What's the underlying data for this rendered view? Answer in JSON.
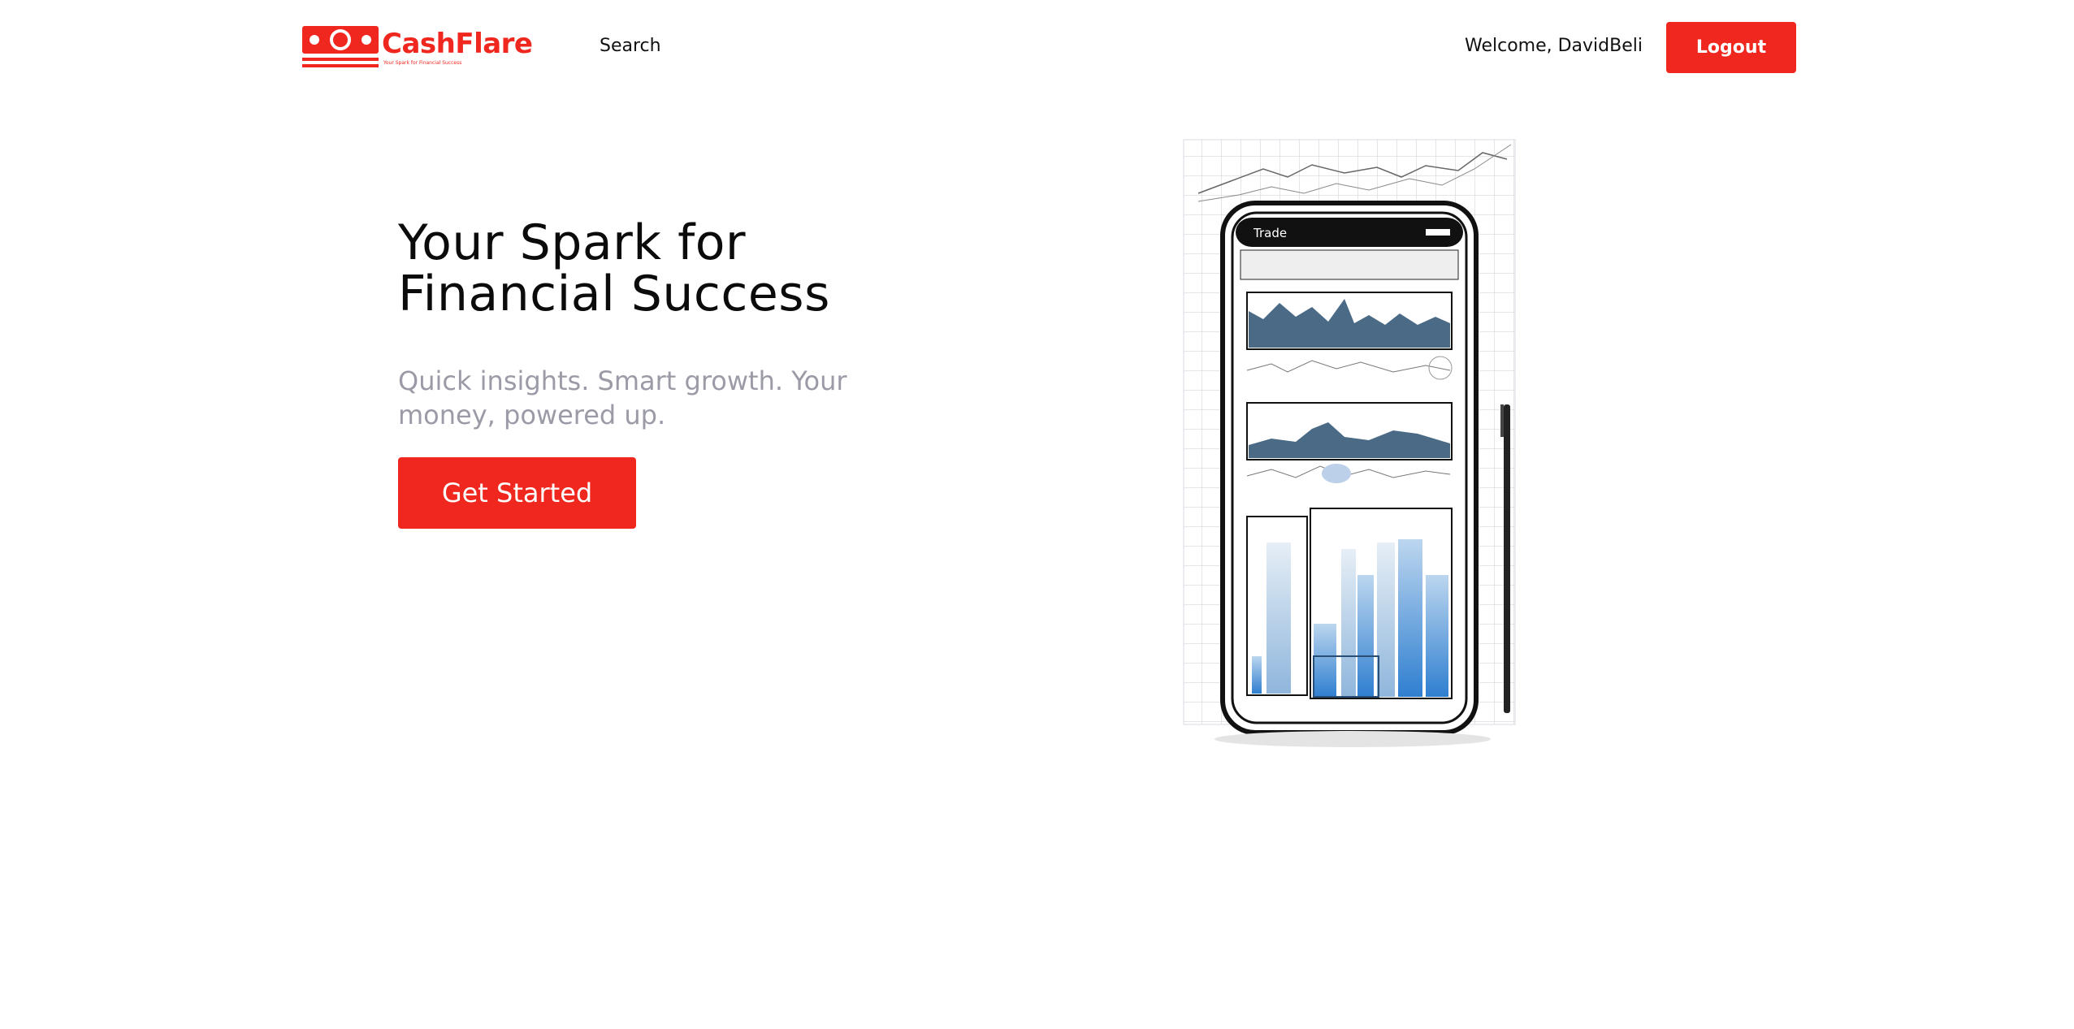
{
  "colors": {
    "accent": "#f0271e",
    "subtitle": "#9a9ba6",
    "chart": "#4a6a86",
    "bars": "#3d8fd9"
  },
  "brand": {
    "name": "CashFlare",
    "tagline": "Your Spark for Financial Success"
  },
  "nav": {
    "search_label": "Search"
  },
  "user": {
    "welcome_text": "Welcome, DavidBeli",
    "logout_label": "Logout"
  },
  "hero": {
    "title_line1": "Your Spark for",
    "title_line2": "Financial Success",
    "subtitle": "Quick insights. Smart growth. Your money, powered up.",
    "cta_label": "Get Started"
  },
  "illustration": {
    "phone_app_title": "Trade"
  }
}
